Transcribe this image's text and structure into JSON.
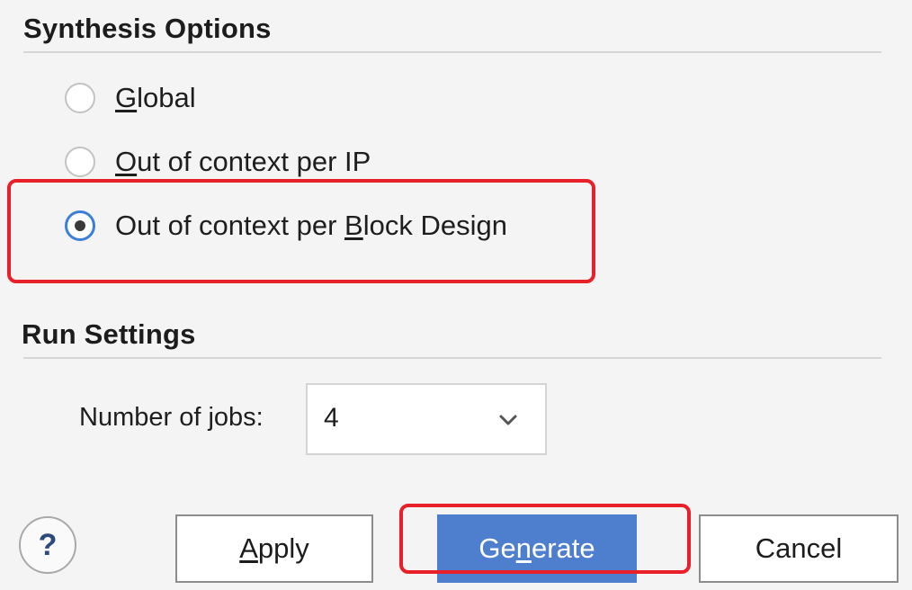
{
  "synthesis": {
    "title": "Synthesis Options",
    "options": [
      {
        "pre": "",
        "mnemonic": "G",
        "post": "lobal",
        "checked": false
      },
      {
        "pre": "",
        "mnemonic": "O",
        "post": "ut of context per IP",
        "checked": false
      },
      {
        "pre": "Out of context per ",
        "mnemonic": "B",
        "post": "lock Design",
        "checked": true
      }
    ]
  },
  "run_settings": {
    "title": "Run Settings",
    "jobs_label_pre": "Number of ",
    "jobs_label_mnemonic": "j",
    "jobs_label_post": "obs:",
    "jobs_value": "4"
  },
  "buttons": {
    "help": "?",
    "apply_mnemonic": "A",
    "apply_rest": "pply",
    "generate_pre": "Ge",
    "generate_mnemonic": "n",
    "generate_post": "erate",
    "cancel": "Cancel"
  },
  "colors": {
    "highlight": "#e8202a",
    "primary": "#4e7fce",
    "radio_checked": "#3c7fd9"
  },
  "icons": {
    "select_chevron": "chevron-down-icon",
    "help": "help-icon"
  }
}
